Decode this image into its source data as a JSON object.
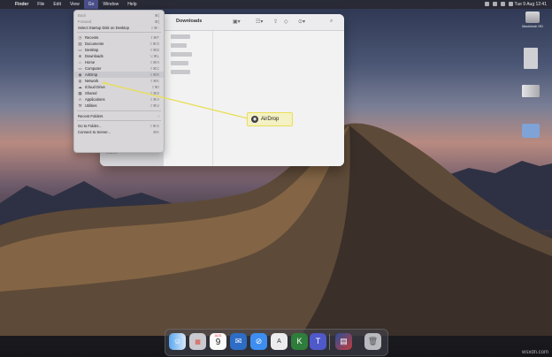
{
  "menubar": {
    "app": "Finder",
    "items": [
      "File",
      "Edit",
      "View",
      "Go",
      "Window",
      "Help"
    ],
    "active": "Go",
    "clock": "Tue 9 Aug  12:41"
  },
  "go_menu": {
    "back": "Back",
    "forward": "Forward",
    "select_startup": "Select Startup Disk on Desktop",
    "places": [
      {
        "label": "Recents",
        "icon": "clock-icon",
        "glyph": "◷"
      },
      {
        "label": "Documents",
        "icon": "document-icon",
        "glyph": "▤"
      },
      {
        "label": "Desktop",
        "icon": "desktop-icon",
        "glyph": "▭"
      },
      {
        "label": "Downloads",
        "icon": "download-icon",
        "glyph": "⊕"
      },
      {
        "label": "Home",
        "icon": "home-icon",
        "glyph": "⌂"
      },
      {
        "label": "Computer",
        "icon": "computer-icon",
        "glyph": "▭"
      },
      {
        "label": "AirDrop",
        "icon": "airdrop-icon",
        "glyph": "◉"
      },
      {
        "label": "Network",
        "icon": "network-icon",
        "glyph": "◍"
      },
      {
        "label": "iCloud Drive",
        "icon": "cloud-icon",
        "glyph": "☁"
      },
      {
        "label": "Shared",
        "icon": "shared-folder-icon",
        "glyph": "▦"
      },
      {
        "label": "Applications",
        "icon": "applications-icon",
        "glyph": "A"
      },
      {
        "label": "Utilities",
        "icon": "utilities-icon",
        "glyph": "⚒"
      }
    ],
    "recent_folders": "Recent Folders",
    "go_to_folder": "Go to Folder...",
    "connect_to_server": "Connect to Server..."
  },
  "finder": {
    "title": "Downloads",
    "sidebar_label": "Shared"
  },
  "callout": {
    "label": "AirDrop",
    "border_color": "#e8df55",
    "fill_color": "#f4f1c4"
  },
  "desktop": {
    "hdd_label": "Macintosh HD"
  },
  "dock": {
    "calendar_month": "AUG",
    "calendar_day": "9",
    "apps": [
      "finder-icon",
      "launchpad-icon",
      "calendar-icon",
      "thunderbird-icon",
      "safari-icon",
      "font-book-icon",
      "keka-icon",
      "teams-icon",
      "photo-folder-icon",
      "trash-icon"
    ]
  },
  "watermark": "wsxdn.com"
}
